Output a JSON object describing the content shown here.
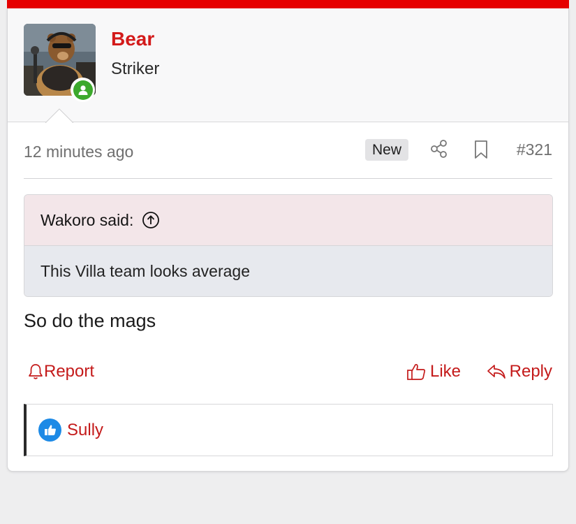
{
  "post": {
    "author": {
      "name": "Bear",
      "title": "Striker",
      "online": true
    },
    "meta": {
      "time": "12 minutes ago",
      "new_badge": "New",
      "post_number": "#321"
    },
    "quote": {
      "attribution": "Wakoro said:",
      "text": "This Villa team looks average"
    },
    "message": "So do the mags",
    "actions": {
      "report": "Report",
      "like": "Like",
      "reply": "Reply"
    },
    "reactions": {
      "users": [
        "Sully"
      ]
    }
  },
  "colors": {
    "brand_red": "#e60000",
    "link_red": "#c41a1a",
    "username_red": "#d31a1a",
    "online_green": "#3ca92c",
    "like_blue": "#1d8ae6",
    "quote_header_bg": "#f3e6e9",
    "quote_body_bg": "#e7e9ee"
  },
  "icons": {
    "online": "online-indicator-icon",
    "share": "share-icon",
    "bookmark": "bookmark-icon",
    "quote_jump": "arrow-up-circle-icon",
    "report": "bell-icon",
    "like": "thumbs-up-icon",
    "reply": "reply-arrow-icon",
    "reaction": "like-reaction-icon"
  }
}
